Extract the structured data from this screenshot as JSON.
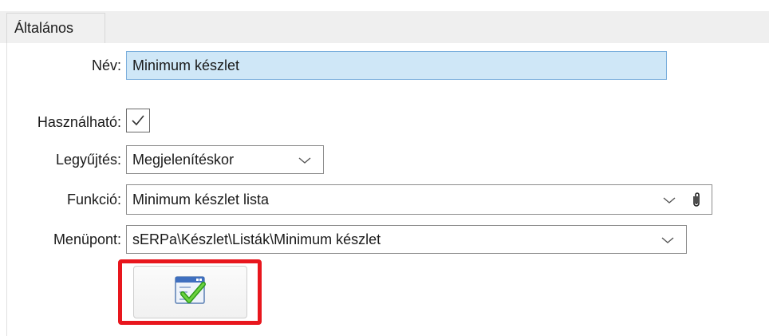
{
  "tabs": [
    {
      "label": "Általános"
    }
  ],
  "form": {
    "nev": {
      "label": "Név:",
      "value": "Minimum készlet"
    },
    "hasznalhato": {
      "label": "Használható:",
      "checked": true
    },
    "legyujtes": {
      "label": "Legyűjtés:",
      "value": "Megjelenítéskor"
    },
    "funkcio": {
      "label": "Funkció:",
      "value": "Minimum készlet lista"
    },
    "menupont": {
      "label": "Menüpont:",
      "value": "sERPa\\Készlet\\Listák\\Minimum készlet"
    }
  },
  "icons": {
    "ok": "ok-check-icon",
    "attach": "paperclip-icon",
    "dropdown": "chevron-down-icon"
  },
  "colors": {
    "focused_field": "#cfe7f7",
    "highlight": "#e8161d",
    "check": "#3daa1f"
  }
}
